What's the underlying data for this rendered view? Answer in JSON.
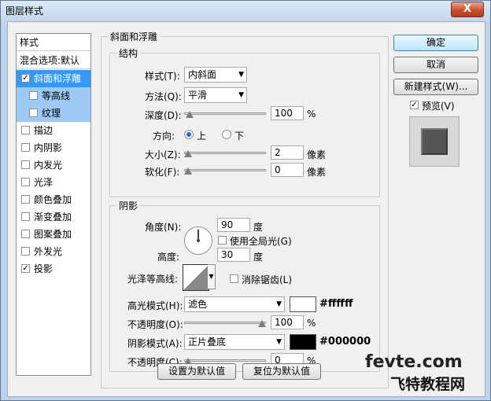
{
  "window": {
    "title": "图层样式",
    "close_label": "X"
  },
  "sidebar": {
    "header": "样式",
    "blend_options": "混合选项:默认",
    "items": [
      {
        "label": "斜面和浮雕",
        "checked": true
      },
      {
        "label": "等高线",
        "checked": false
      },
      {
        "label": "纹理",
        "checked": false
      },
      {
        "label": "描边",
        "checked": false
      },
      {
        "label": "内阴影",
        "checked": false
      },
      {
        "label": "内发光",
        "checked": false
      },
      {
        "label": "光泽",
        "checked": false
      },
      {
        "label": "颜色叠加",
        "checked": false
      },
      {
        "label": "渐变叠加",
        "checked": false
      },
      {
        "label": "图案叠加",
        "checked": false
      },
      {
        "label": "外发光",
        "checked": false
      },
      {
        "label": "投影",
        "checked": true
      }
    ]
  },
  "bevel": {
    "section_title": "斜面和浮雕",
    "structure_title": "结构",
    "style_label": "样式(T):",
    "style_value": "内斜面",
    "technique_label": "方法(Q):",
    "technique_value": "平滑",
    "depth_label": "深度(D):",
    "depth_value": "100",
    "depth_unit": "%",
    "depth_slider": 0.02,
    "direction_label": "方向:",
    "direction_up": "上",
    "direction_down": "下",
    "size_label": "大小(Z):",
    "size_value": "2",
    "size_unit": "像素",
    "size_slider": 0.0,
    "soften_label": "软化(F):",
    "soften_value": "0",
    "soften_unit": "像素",
    "soften_slider": 0.0
  },
  "shading": {
    "title": "阴影",
    "angle_label": "角度(N):",
    "angle_value": "90",
    "angle_unit": "度",
    "global_light_label": "使用全局光(G)",
    "altitude_label": "高度:",
    "altitude_value": "30",
    "altitude_unit": "度",
    "gloss_label": "光泽等高线:",
    "antialias_label": "消除锯齿(L)",
    "highlight_label": "高光模式(H):",
    "highlight_mode": "滤色",
    "highlight_color": "#ffffff",
    "highlight_hex": "#ffffff",
    "highlight_opacity_label": "不透明度(O):",
    "highlight_opacity": "100",
    "highlight_opacity_unit": "%",
    "highlight_opacity_slider": 1.0,
    "shadow_label": "阴影模式(A):",
    "shadow_mode": "正片叠底",
    "shadow_color": "#000000",
    "shadow_hex": "#000000",
    "shadow_opacity_label": "不透明度(C):",
    "shadow_opacity": "0",
    "shadow_opacity_unit": "%",
    "shadow_opacity_slider": 0.0
  },
  "footer": {
    "make_default": "设置为默认值",
    "reset_default": "复位为默认值"
  },
  "actions": {
    "ok": "确定",
    "cancel": "取消",
    "new_style": "新建样式(W)...",
    "preview_label": "预览(V)"
  },
  "watermark": {
    "line1": "fevte.com",
    "line2": "飞特教程网"
  }
}
